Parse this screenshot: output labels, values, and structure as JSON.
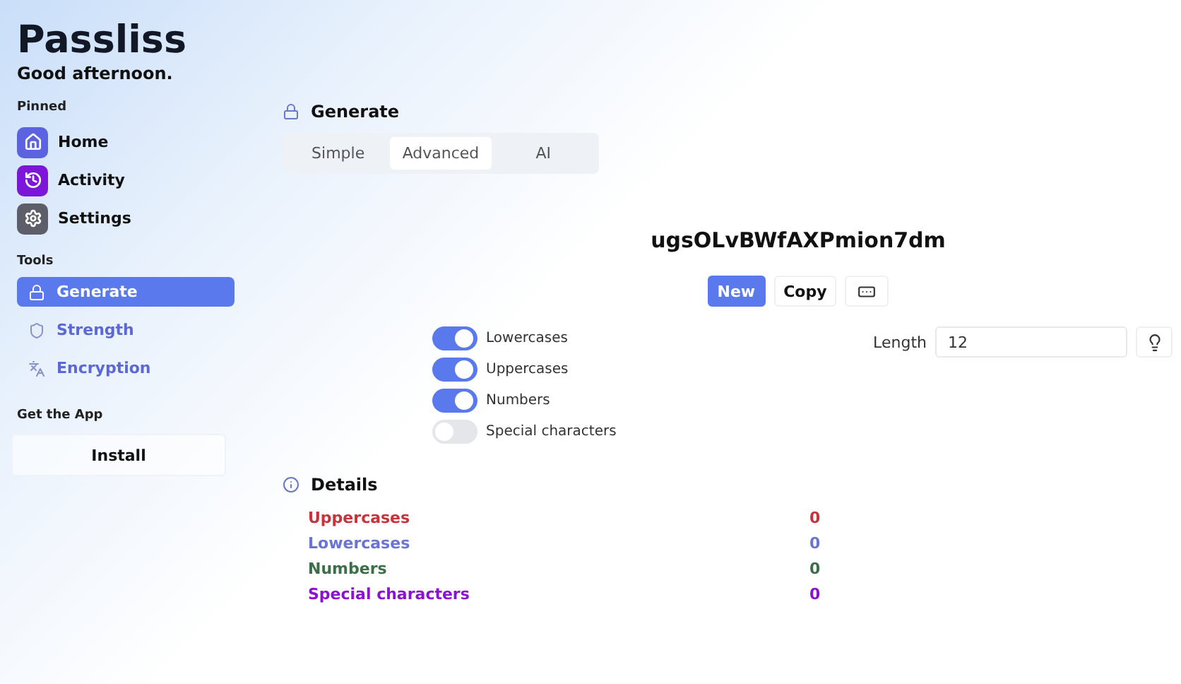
{
  "app": {
    "title": "Passliss",
    "greeting": "Good afternoon."
  },
  "sidebar": {
    "sections": [
      {
        "heading": "Pinned",
        "kind": "pinned",
        "items": [
          {
            "label": "Home",
            "color": "#5b63e0",
            "selected": false
          },
          {
            "label": "Activity",
            "color": "#7c16d8",
            "selected": false
          },
          {
            "label": "Settings",
            "color": "#5c5f6a",
            "selected": false
          }
        ]
      },
      {
        "heading": "Tools",
        "kind": "tools",
        "items": [
          {
            "label": "Generate",
            "selected": true
          },
          {
            "label": "Strength",
            "selected": false
          },
          {
            "label": "Encryption",
            "selected": false
          }
        ]
      },
      {
        "heading": "Get the App",
        "kind": "install",
        "button": "Install"
      }
    ]
  },
  "page": {
    "title": "Generate",
    "tabs": [
      {
        "label": "Simple",
        "selected": false
      },
      {
        "label": "Advanced",
        "selected": true
      },
      {
        "label": "AI",
        "selected": false
      }
    ],
    "password": "ugsOLvBWfAXPmion7dm",
    "actions": [
      {
        "label": "New",
        "kind": "primary"
      },
      {
        "label": "Copy",
        "kind": "plain"
      },
      {
        "kind": "icon"
      }
    ],
    "options": [
      {
        "label": "Lowercases",
        "on": true
      },
      {
        "label": "Uppercases",
        "on": true
      },
      {
        "label": "Numbers",
        "on": true
      },
      {
        "label": "Special characters",
        "on": false
      }
    ],
    "length": {
      "label": "Length",
      "value": "12"
    },
    "details": {
      "title": "Details",
      "rows": [
        {
          "label": "Uppercases",
          "value": "0",
          "color": "#c8323a"
        },
        {
          "label": "Lowercases",
          "value": "0",
          "color": "#6874d6"
        },
        {
          "label": "Numbers",
          "value": "0",
          "color": "#3c6e4a"
        },
        {
          "label": "Special characters",
          "value": "0",
          "color": "#8a12d0"
        }
      ]
    }
  }
}
